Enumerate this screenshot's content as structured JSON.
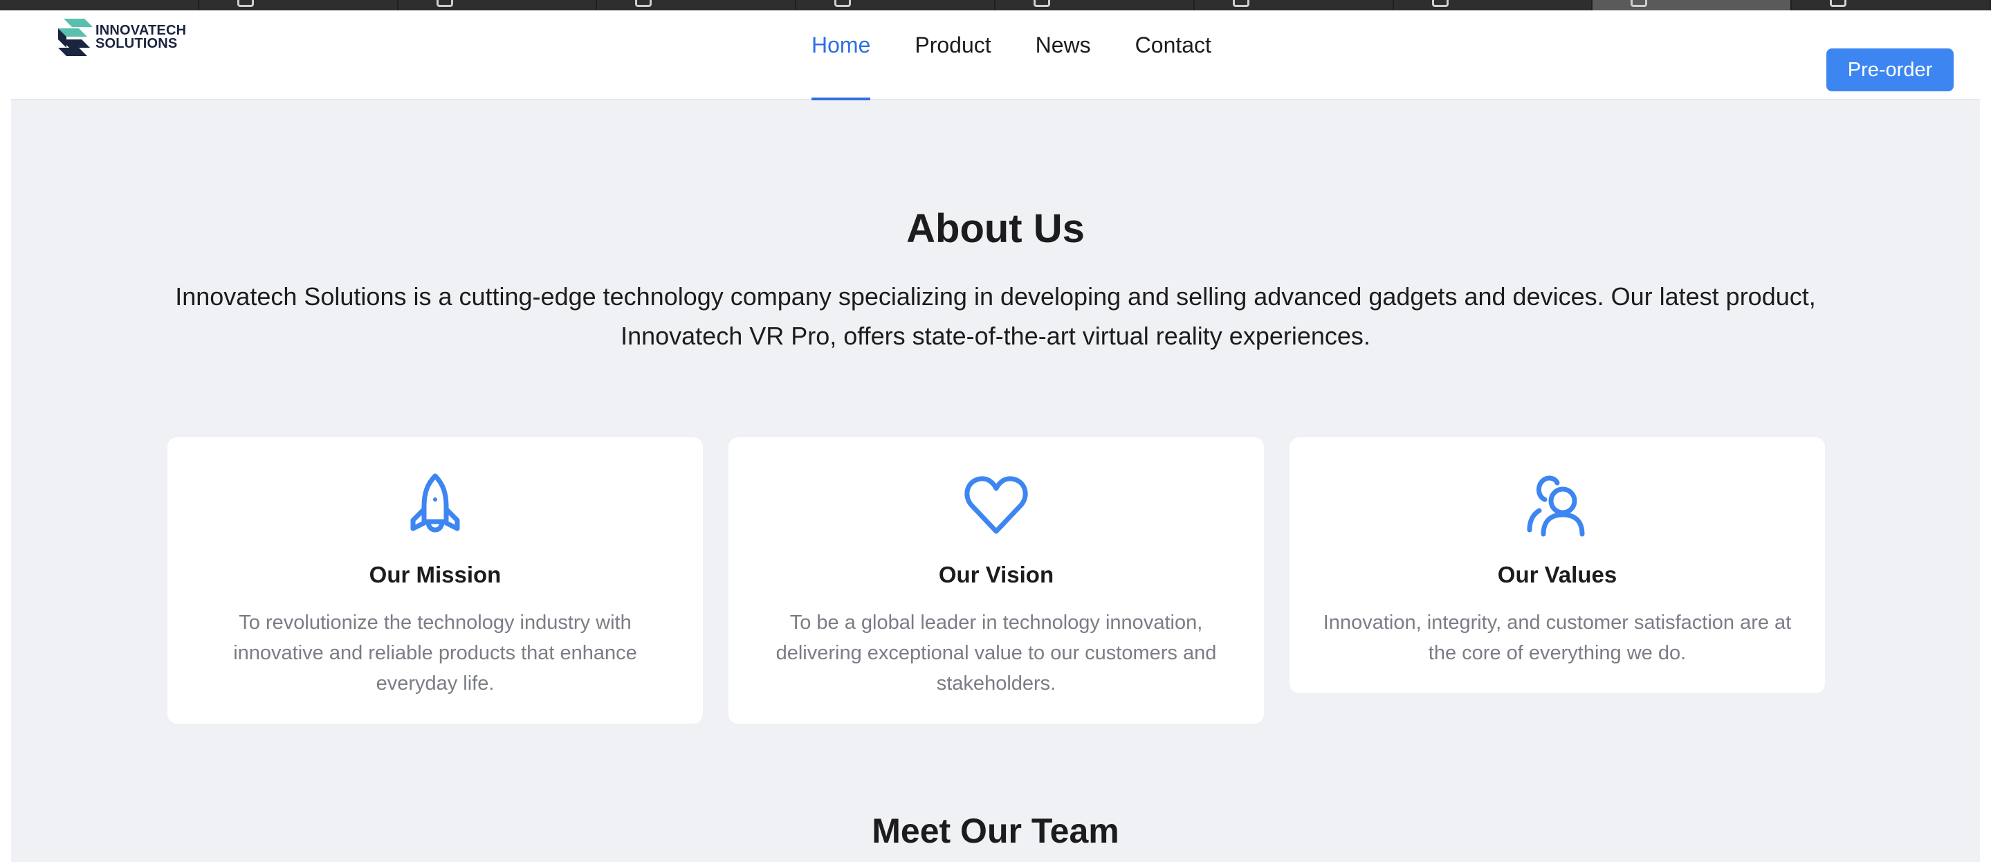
{
  "logo": {
    "line1": "INNOVATECH",
    "line2": "SOLUTIONS",
    "colors": {
      "teal": "#5bbfae",
      "navy": "#1b2540"
    }
  },
  "nav": {
    "items": [
      {
        "label": "Home",
        "active": true
      },
      {
        "label": "Product",
        "active": false
      },
      {
        "label": "News",
        "active": false
      },
      {
        "label": "Contact",
        "active": false
      }
    ],
    "active_color": "#2f6fe0"
  },
  "header": {
    "preorder_label": "Pre-order",
    "preorder_color": "#3d86f2"
  },
  "about": {
    "title": "About Us",
    "text": "Innovatech Solutions is a cutting-edge technology company specializing in developing and selling advanced gadgets and devices. Our latest product, Innovatech VR Pro, offers state-of-the-art virtual reality experiences."
  },
  "cards": [
    {
      "icon": "rocket-icon",
      "title": "Our Mission",
      "text": "To revolutionize the technology industry with innovative and reliable products that enhance everyday life."
    },
    {
      "icon": "heart-icon",
      "title": "Our Vision",
      "text": "To be a global leader in technology innovation, delivering exceptional value to our customers and stakeholders."
    },
    {
      "icon": "users-icon",
      "title": "Our Values",
      "text": "Innovation, integrity, and customer satisfaction are at the core of everything we do."
    }
  ],
  "team": {
    "title": "Meet Our Team"
  },
  "icon_color": "#3d86f2"
}
